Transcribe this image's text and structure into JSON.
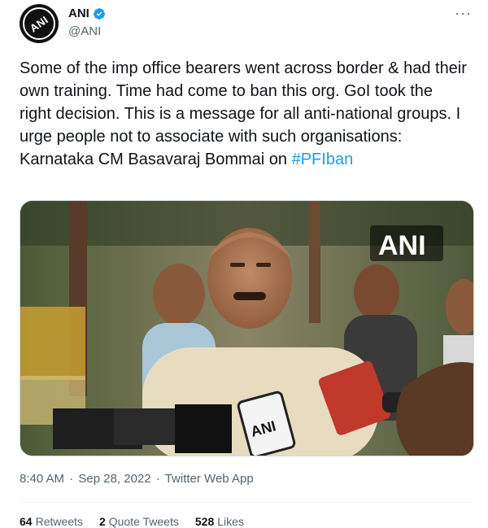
{
  "account": {
    "display_name": "ANI",
    "handle": "@ANI",
    "avatar_text": "ANI",
    "verified": true
  },
  "menu": {
    "more_label": "···"
  },
  "tweet": {
    "text": "Some of the imp office bearers went across border & had their own training. Time had come to ban this org. GoI took the right decision. This is a message for all anti-national groups. I urge people not to associate with such organisations: Karnataka CM Basavaraj Bommai on ",
    "hashtag": "#PFIban"
  },
  "media": {
    "watermark": "ANI",
    "mic_label": "ANI"
  },
  "meta": {
    "time": "8:40 AM",
    "separator": "·",
    "date": "Sep 28, 2022",
    "source": "Twitter Web App"
  },
  "stats": {
    "retweets_count": "64",
    "retweets_label": "Retweets",
    "quotes_count": "2",
    "quotes_label": "Quote Tweets",
    "likes_count": "528",
    "likes_label": "Likes"
  },
  "colors": {
    "link": "#1d9bf0",
    "secondary_text": "#536471",
    "primary_text": "#0f1419"
  }
}
